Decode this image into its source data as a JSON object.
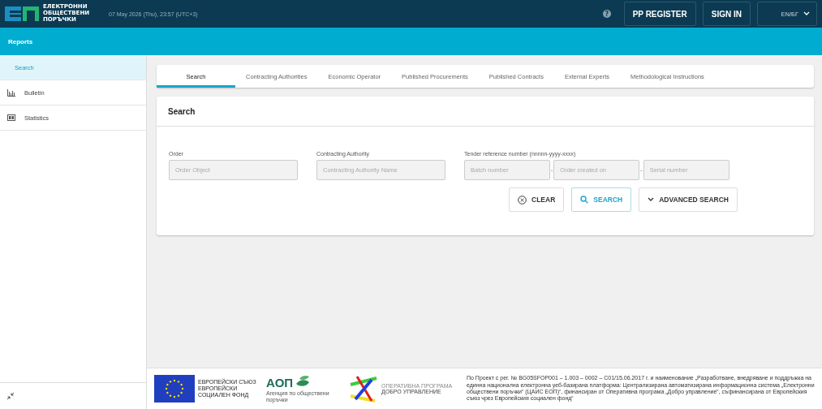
{
  "header": {
    "logo_text": "ЕЛЕКТРОННИ ОБЩЕСТВЕНИ ПОРЪЧКИ",
    "datetime": "07 May 2026 (Thu), 23:57 (UTC+3)",
    "help": "?",
    "buttons": [
      "PP REGISTER",
      "SIGN IN"
    ],
    "language": "EN/БГ"
  },
  "section_bar": {
    "title": "Reports"
  },
  "sidebar": {
    "items": [
      {
        "label": "Search",
        "kind": "plain",
        "selected": true
      },
      {
        "label": "Bulletin",
        "kind": "chart",
        "selected": false
      },
      {
        "label": "Statistics",
        "kind": "card",
        "selected": false
      }
    ]
  },
  "tabs": [
    {
      "label": "Search",
      "selected": true
    },
    {
      "label": "Contracting Authorities",
      "selected": false
    },
    {
      "label": "Economic Operator",
      "selected": false
    },
    {
      "label": "Published Procurements",
      "selected": false
    },
    {
      "label": "Published Contracts",
      "selected": false
    },
    {
      "label": "External Experts",
      "selected": false
    },
    {
      "label": "Methodological Instructions",
      "selected": false
    }
  ],
  "search_panel": {
    "title": "Search",
    "fields": [
      {
        "label": "Order",
        "inputs": [
          {
            "placeholder": "Order Object"
          }
        ]
      },
      {
        "label": "Contracting Authority",
        "inputs": [
          {
            "placeholder": "Contracting Authority Name"
          }
        ]
      },
      {
        "label": "Tender reference number (nnnnn-yyyy-xxxx)",
        "separator": "-",
        "inputs": [
          {
            "placeholder": "Batch number"
          },
          {
            "placeholder": "Order created on"
          },
          {
            "placeholder": "Serial number"
          }
        ]
      }
    ],
    "buttons": [
      {
        "label": "CLEAR",
        "kind": "clear"
      },
      {
        "label": "SEARCH",
        "kind": "search"
      },
      {
        "label": "ADVANCED SEARCH",
        "kind": "advanced"
      }
    ]
  },
  "footer": {
    "eu_text": "ЕВРОПЕЙСКИ СЪЮЗ ЕВРОПЕЙСКИ СОЦИАЛЕН ФОНД",
    "aop_name": "АОП",
    "aop_text": "Агенция по обществени поръчки",
    "program_caption": "ОПЕРАТИВНА ПРОГРАМА",
    "program_name": "ДОБРО УПРАВЛЕНИЕ",
    "project_text": "По Проект с рег. № BG05SFOP001 – 1.003 – 0002 – C01/15.06.2017 г. и наименование „Разработване, внедряване и поддръжка на единна национална електронна уеб-базирана платформа: Централизирана автоматизирана информационна система „Електронни обществени поръчки“ (ЦАИС ЕОП)“, финансиран от Оперативна програма „Добро управление“, съфинансирана от Европейския съюз чрез Европейския социален фонд“"
  }
}
